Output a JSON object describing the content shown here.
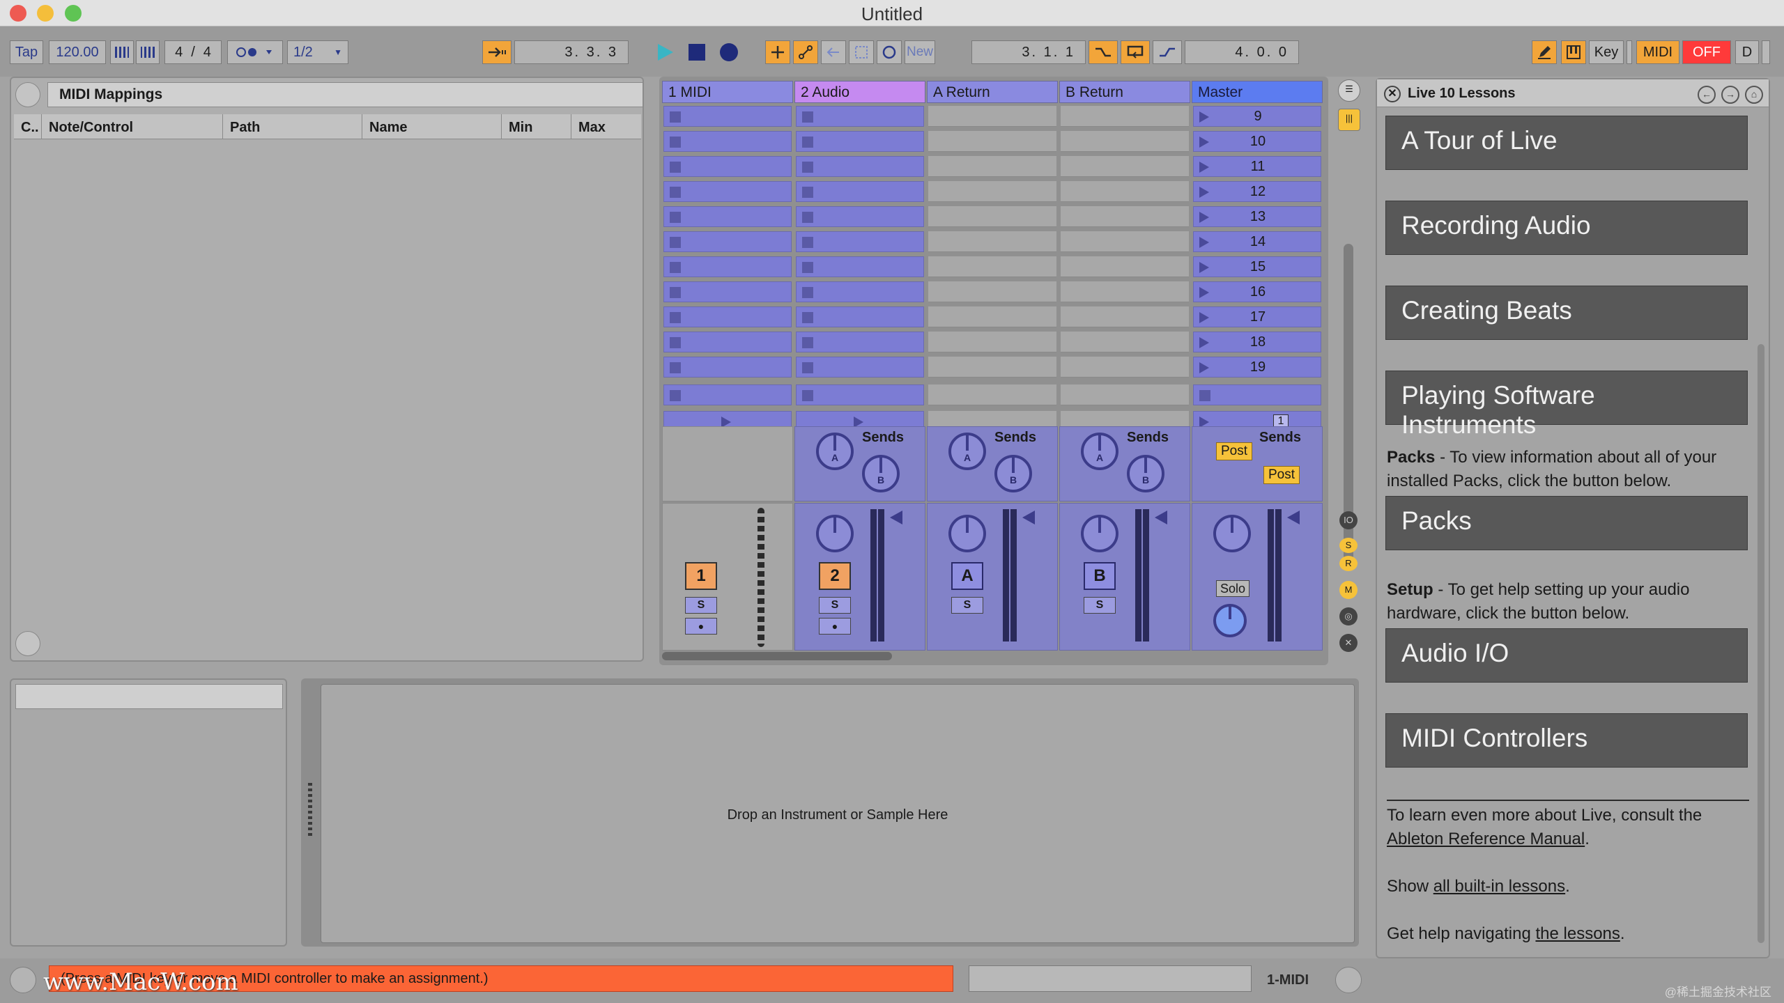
{
  "window": {
    "title": "Untitled"
  },
  "controlbar": {
    "tap": "Tap",
    "tempo": "120.00",
    "signature_num": "4",
    "signature_slash": "/",
    "signature_den": "4",
    "quantize": "1/2",
    "arrangement_position": "3.  3.  3",
    "new_label": "New",
    "loop_start": "3.   1.   1",
    "loop_length": "4.   0.   0",
    "key": "Key",
    "midi": "MIDI",
    "off": "OFF",
    "d": "D"
  },
  "browser": {
    "title": "MIDI Mappings",
    "columns": [
      "C..",
      "Note/Control",
      "Path",
      "Name",
      "Min",
      "Max"
    ]
  },
  "session": {
    "tracks": [
      {
        "name": "1 MIDI",
        "color": "#8a8ae0",
        "number": "1",
        "solo": "S"
      },
      {
        "name": "2 Audio",
        "color": "#c58af0",
        "number": "2",
        "solo": "S"
      },
      {
        "name": "A Return",
        "color": "#8a8ae0",
        "number": "A",
        "solo": "S"
      },
      {
        "name": "B Return",
        "color": "#8a8ae0",
        "number": "B",
        "solo": "S"
      },
      {
        "name": "Master",
        "color": "#5c7cf0"
      }
    ],
    "scene_numbers": [
      "9",
      "10",
      "11",
      "12",
      "13",
      "14",
      "15",
      "16",
      "17",
      "18",
      "19"
    ],
    "master_sub": "1",
    "sends_label": "Sends",
    "knob_a": "A",
    "knob_b": "B",
    "post_label": "Post",
    "solo_label": "Solo",
    "side_letters": [
      "S",
      "R",
      "M"
    ]
  },
  "lessons": {
    "title": "Live 10 Lessons",
    "buttons": [
      "A Tour of Live",
      "Recording Audio",
      "Creating Beats",
      "Playing Software Instruments",
      "Packs",
      "Audio I/O",
      "MIDI Controllers"
    ],
    "packs_head": "Packs",
    "packs_text": " - To view information about all of your installed Packs, click the button below.",
    "setup_head": "Setup",
    "setup_text": " - To get help setting up your audio hardware, click the button below.",
    "more_text": "To learn even more about Live, consult the ",
    "manual_link": "Ableton Reference Manual",
    "period": ".",
    "show_text": "Show ",
    "builtin_link": "all built-in lessons",
    "help_text": "Get help navigating ",
    "lessons_link": "the lessons"
  },
  "detail": {
    "drop_label": "Drop an Instrument or Sample Here"
  },
  "status": {
    "message": "(Press a MIDI key or move a MIDI controller to make an assignment.)",
    "track": "1-MIDI",
    "watermark": "www.MacW.com",
    "watermark_2": "@稀土掘金技术社区"
  }
}
